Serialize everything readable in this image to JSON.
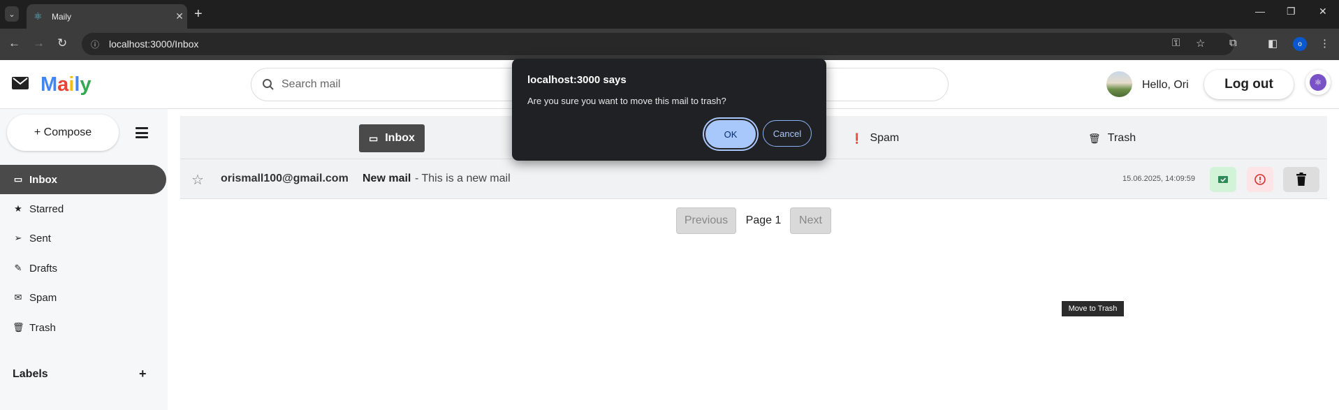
{
  "browser": {
    "tab_title": "Maily",
    "url": "localhost:3000/Inbox",
    "profile_initial": "o"
  },
  "app": {
    "logo_letters": [
      {
        "ch": "M",
        "color": "#4285f4"
      },
      {
        "ch": "a",
        "color": "#ea4335"
      },
      {
        "ch": "i",
        "color": "#fbbc05"
      },
      {
        "ch": "l",
        "color": "#4285f4"
      },
      {
        "ch": "y",
        "color": "#34a853"
      }
    ],
    "search_placeholder": "Search mail",
    "greeting": "Hello, Ori",
    "logout_label": "Log out"
  },
  "sidebar": {
    "compose_label": "+ Compose",
    "items": [
      {
        "label": "Inbox",
        "icon": "inbox-icon",
        "active": true
      },
      {
        "label": "Starred",
        "icon": "star-icon",
        "active": false
      },
      {
        "label": "Sent",
        "icon": "paper-plane-icon",
        "active": false
      },
      {
        "label": "Drafts",
        "icon": "edit-icon",
        "active": false
      },
      {
        "label": "Spam",
        "icon": "envelope-icon",
        "active": false
      },
      {
        "label": "Trash",
        "icon": "trash-icon",
        "active": false
      }
    ],
    "labels_heading": "Labels",
    "labels_add": "+"
  },
  "main": {
    "tabs": [
      {
        "label": "Inbox",
        "icon": "inbox-icon",
        "active": true
      },
      {
        "label": "Spam",
        "icon": "exclamation-icon",
        "active": false
      },
      {
        "label": "Trash",
        "icon": "trash-icon",
        "active": false
      }
    ],
    "mails": [
      {
        "sender": "orismall100@gmail.com",
        "subject": "New mail",
        "snippet": "- This is a new mail",
        "date": "15.06.2025, 14:09:59"
      }
    ],
    "pagination": {
      "previous": "Previous",
      "page": "Page 1",
      "next": "Next"
    },
    "tooltip": "Move to Trash"
  },
  "dialog": {
    "title": "localhost:3000 says",
    "message": "Are you sure you want to move this mail to trash?",
    "ok": "OK",
    "cancel": "Cancel"
  },
  "colors": {
    "accent_dark": "#4a4a4a",
    "dialog_bg": "#202124",
    "dialog_ok": "#a8c7fa"
  }
}
